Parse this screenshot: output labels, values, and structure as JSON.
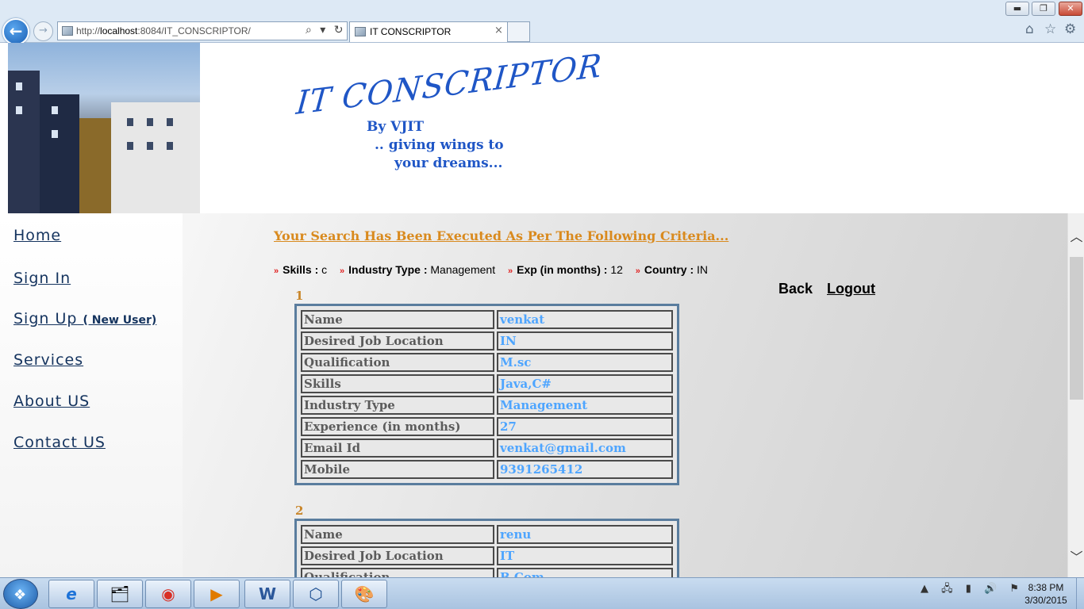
{
  "browser": {
    "url_prefix": "http://",
    "url_host": "localhost",
    "url_rest": ":8084/IT_CONSCRIPTOR/",
    "tab_title": "IT CONSCRIPTOR",
    "tab_close": "×",
    "address_tools": "⌕ ▾ ↻",
    "back_glyph": "←",
    "forward_glyph": "→",
    "window_buttons": {
      "minimize": "▬",
      "restore": "❐",
      "close": "✕"
    },
    "toolbar_icons": [
      "home-icon",
      "favorites-star-icon",
      "settings-gear-icon"
    ],
    "toolbar_glyphs": {
      "home": "⌂",
      "favorites": "☆",
      "settings": "⚙"
    }
  },
  "header": {
    "logo_text": "IT CONSCRIPTOR",
    "tagline_1": "By VJIT",
    "tagline_2": ".. giving wings to",
    "tagline_3": "your dreams..."
  },
  "sidebar": {
    "items": [
      {
        "label": "Home"
      },
      {
        "label": "Sign In"
      },
      {
        "label": "Sign Up",
        "note": "( New User)"
      },
      {
        "label": "Services"
      },
      {
        "label": "About US"
      },
      {
        "label": "Contact US"
      }
    ]
  },
  "main": {
    "heading": "Your Search Has Been Executed As Per The Following Criteria...",
    "arrow": "»",
    "criteria": [
      {
        "label": "Skills :",
        "value": "c"
      },
      {
        "label": "Industry Type :",
        "value": "Management"
      },
      {
        "label": "Exp (in months) :",
        "value": "12"
      },
      {
        "label": "Country :",
        "value": "IN"
      }
    ],
    "back_label": "Back",
    "logout_label": "Logout",
    "results": [
      {
        "number": "1",
        "rows": [
          {
            "key": "Name",
            "value": "venkat"
          },
          {
            "key": "Desired Job Location",
            "value": "IN"
          },
          {
            "key": "Qualification",
            "value": "M.sc"
          },
          {
            "key": "Skills",
            "value": "Java,C#"
          },
          {
            "key": "Industry Type",
            "value": "Management"
          },
          {
            "key": "Experience (in months)",
            "value": "27"
          },
          {
            "key": "Email Id",
            "value": "venkat@gmail.com"
          },
          {
            "key": "Mobile",
            "value": "9391265412"
          }
        ]
      },
      {
        "number": "2",
        "rows": [
          {
            "key": "Name",
            "value": "renu"
          },
          {
            "key": "Desired Job Location",
            "value": "IT"
          },
          {
            "key": "Qualification",
            "value": "B.Com"
          }
        ]
      }
    ]
  },
  "scrollbar": {
    "up_glyph": "︿",
    "down_glyph": "﹀"
  },
  "taskbar": {
    "apps": [
      "internet-explorer-icon",
      "file-explorer-icon",
      "chrome-icon",
      "media-player-icon",
      "word-icon",
      "virtualbox-icon",
      "paint-icon"
    ],
    "app_glyphs": [
      "e",
      "🗂",
      "◉",
      "▶",
      "W",
      "⬡",
      "🎨"
    ],
    "tray_glyphs": "▲ 🖧 ▮ 🔊 ⚑",
    "time": "8:38 PM",
    "date": "3/30/2015"
  }
}
